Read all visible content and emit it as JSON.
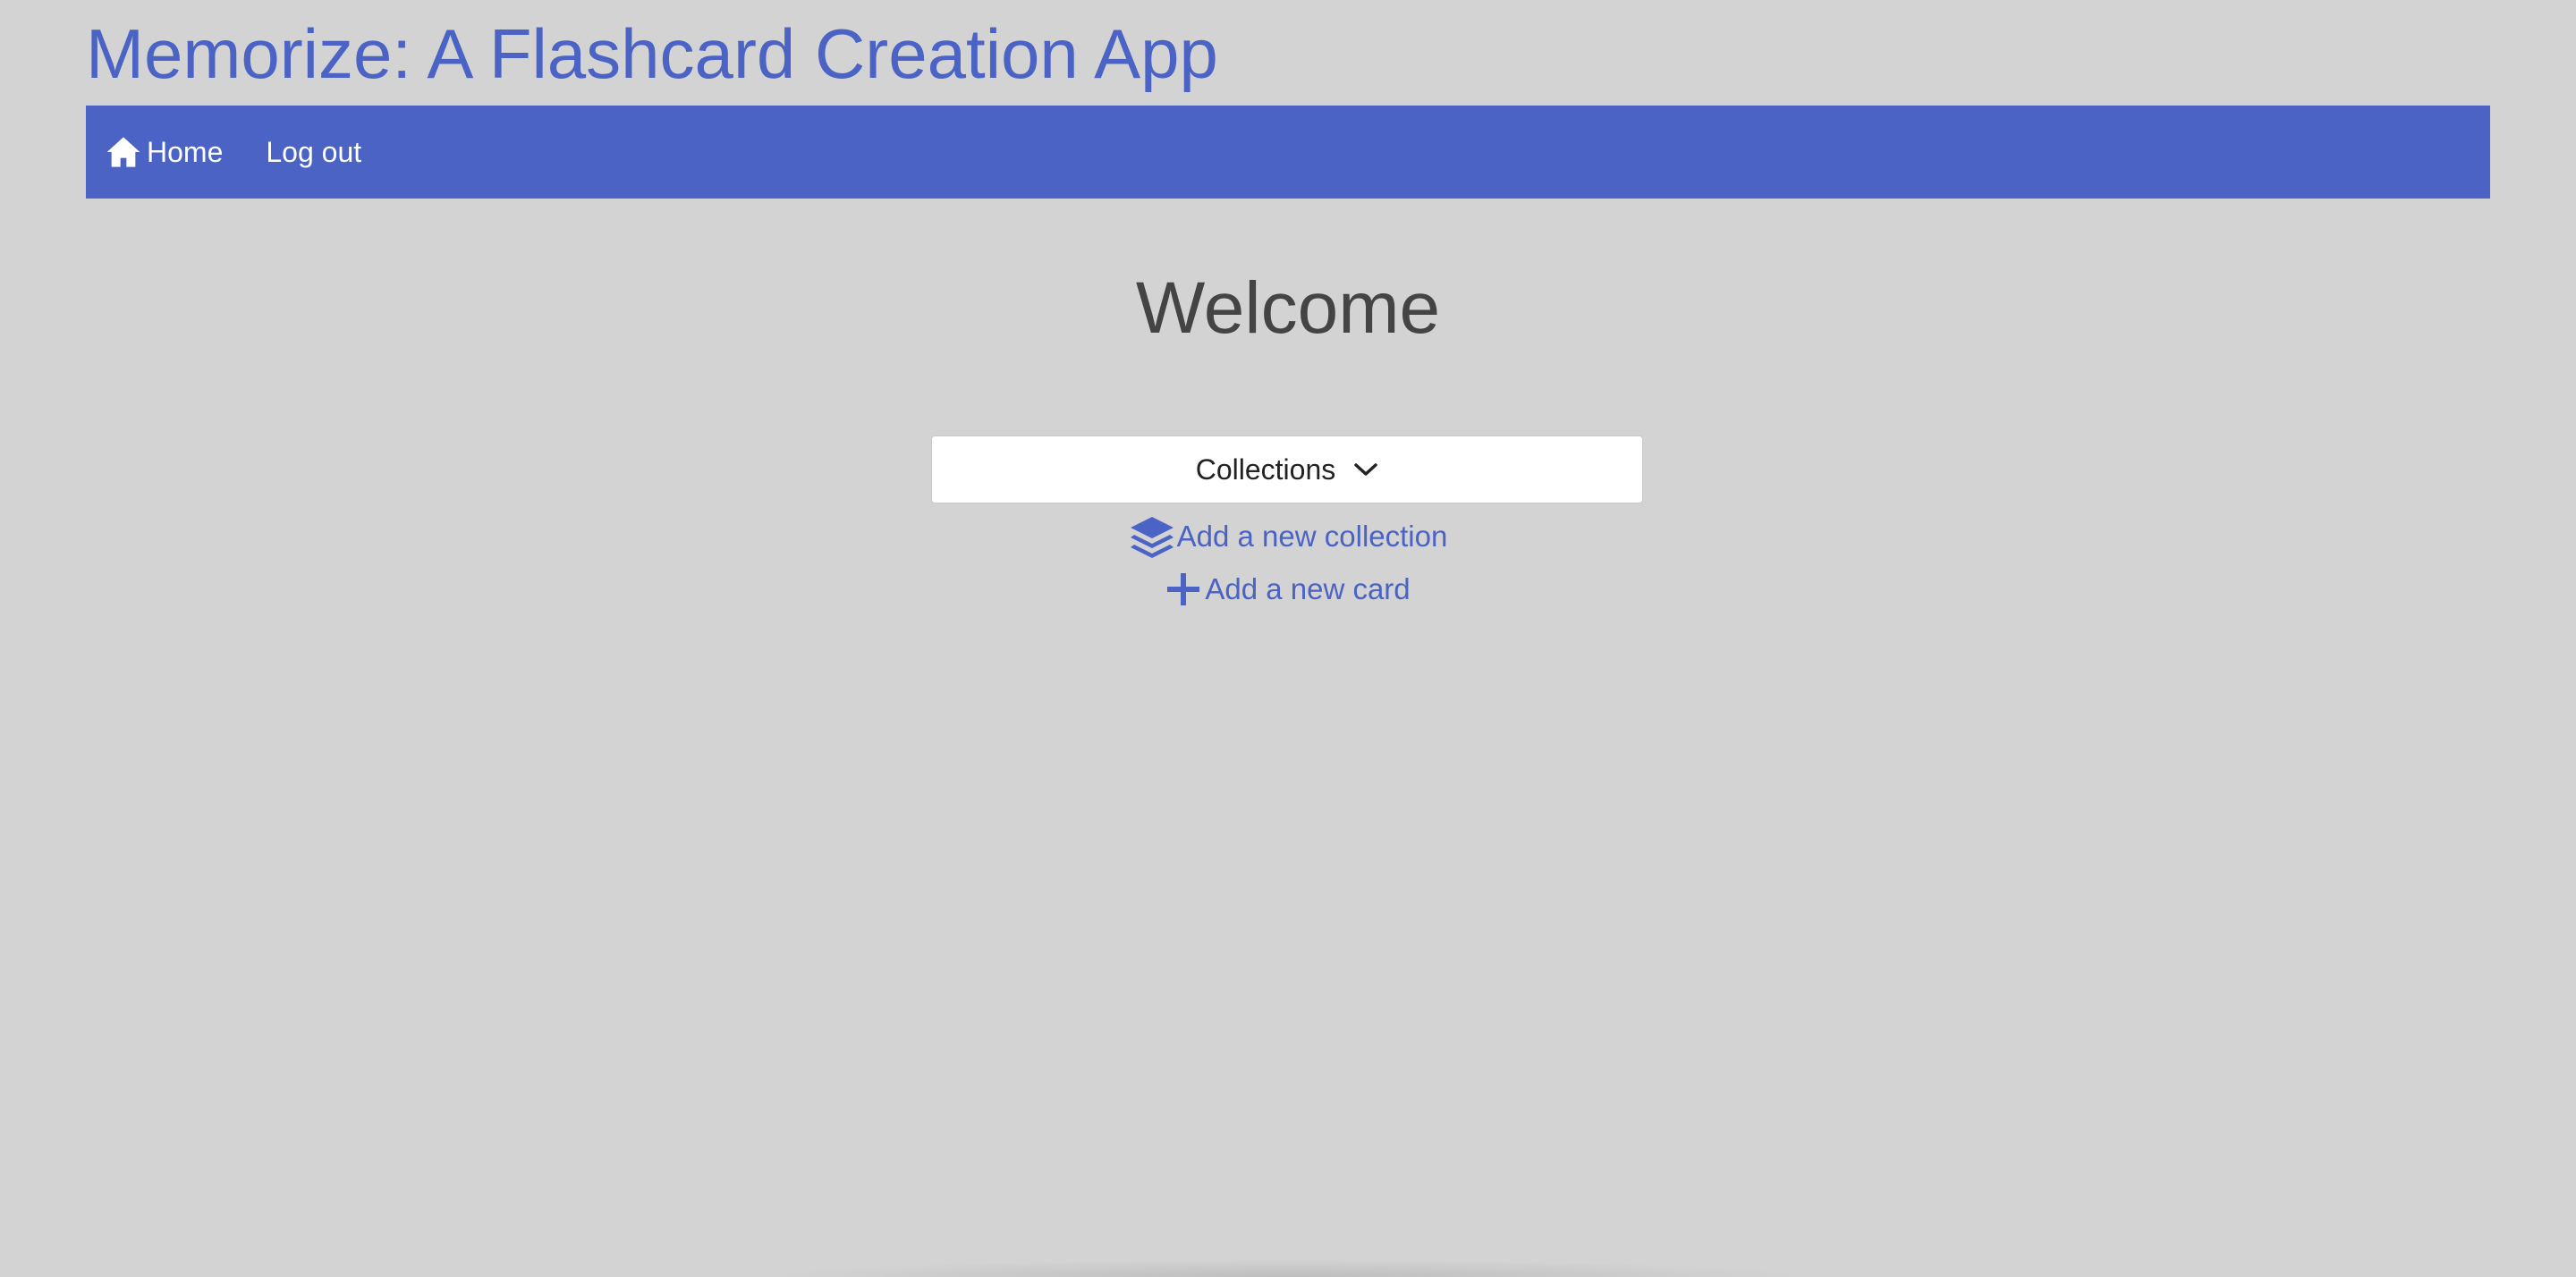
{
  "app": {
    "title": "Memorize: A Flashcard Creation App"
  },
  "nav": {
    "home_label": "Home",
    "home_icon": "home-icon",
    "logout_label": "Log out"
  },
  "main": {
    "heading": "Welcome",
    "collections_dropdown": {
      "label": "Collections",
      "icon": "chevron-down-icon"
    },
    "actions": {
      "add_collection_label": "Add a new collection",
      "add_collection_icon": "layers-icon",
      "add_card_label": "Add a new card",
      "add_card_icon": "plus-icon"
    }
  },
  "colors": {
    "accent": "#4a63c5",
    "background": "#d3d3d3",
    "heading": "#444444",
    "nav_text": "#ffffff"
  }
}
